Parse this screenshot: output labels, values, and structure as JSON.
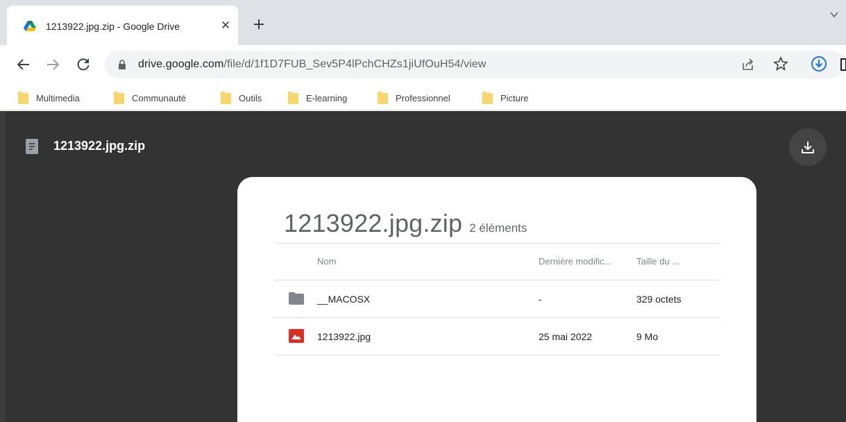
{
  "browser": {
    "tab": {
      "title": "1213922.jpg.zip - Google Drive",
      "close_glyph": "✕",
      "favicon": "google-drive-icon"
    },
    "new_tab_icon": "plus-icon",
    "tab_search_icon": "chevron-down-icon",
    "toolbar": {
      "back_icon": "arrow-left-icon",
      "forward_icon": "arrow-right-icon",
      "reload_icon": "reload-icon",
      "url_host": "drive.google.com",
      "url_path": "/file/d/1f1D7FUB_Sev5P4lPchCHZs1jiUfOuH54/view",
      "share_icon": "share-icon",
      "bookmark_icon": "star-icon",
      "download_icon": "download-circle-icon"
    },
    "bookmarks": [
      {
        "label": "Multimedia"
      },
      {
        "label": "Communauté"
      },
      {
        "label": "Outils"
      },
      {
        "label": "E-learning"
      },
      {
        "label": "Professionnel"
      },
      {
        "label": "Picture"
      }
    ]
  },
  "viewer": {
    "file_title": "1213922.jpg.zip",
    "file_icon": "document-icon",
    "download_icon": "download-icon",
    "card": {
      "name": "1213922.jpg.zip",
      "count": "2 éléments",
      "columns": {
        "name": "Nom",
        "modified": "Dernière modific...",
        "size": "Taille du ..."
      },
      "rows": [
        {
          "icon": "folder-icon",
          "name": "__MACOSX",
          "modified": "-",
          "size": "329 octets"
        },
        {
          "icon": "image-file-icon",
          "name": "1213922.jpg",
          "modified": "25 mai 2022",
          "size": "9 Mo"
        }
      ]
    }
  },
  "colors": {
    "tabstrip": "#dee1e6",
    "viewer_bg": "#333333",
    "accent_blue": "#1a73e8",
    "image_red": "#d93025",
    "folder_gray": "#5f6368",
    "bookmark_folder": "#f9d66b"
  }
}
